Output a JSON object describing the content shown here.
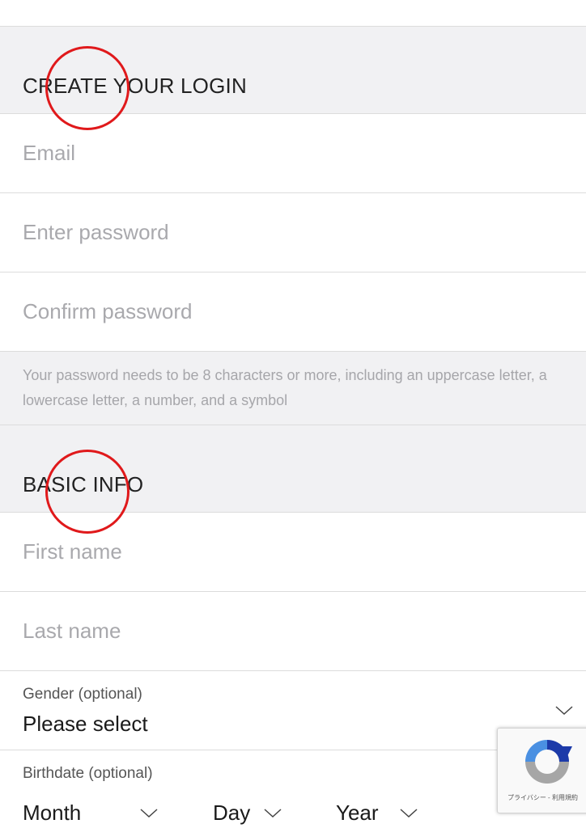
{
  "sections": {
    "login": {
      "title": "CREATE YOUR LOGIN"
    },
    "basic": {
      "title": "BASIC INFO"
    }
  },
  "fields": {
    "email": {
      "placeholder": "Email"
    },
    "password": {
      "placeholder": "Enter password"
    },
    "confirm_password": {
      "placeholder": "Confirm password"
    },
    "first_name": {
      "placeholder": "First name"
    },
    "last_name": {
      "placeholder": "Last name"
    }
  },
  "password_hint": "Your password needs to be 8 characters or more, including an uppercase letter, a lowercase letter, a number, and a symbol",
  "gender": {
    "label": "Gender (optional)",
    "value": "Please select"
  },
  "birthdate": {
    "label": "Birthdate (optional)",
    "month": "Month",
    "day": "Day",
    "year": "Year"
  },
  "recaptcha": {
    "privacy_text": "プライバシー - 利用規約"
  },
  "colors": {
    "annotation_circle": "#e0191b",
    "section_bg": "#f1f1f3",
    "placeholder": "#a9a9ad"
  },
  "icons": {
    "dropdown": "chevron-down-icon",
    "captcha": "recaptcha-logo-icon"
  }
}
